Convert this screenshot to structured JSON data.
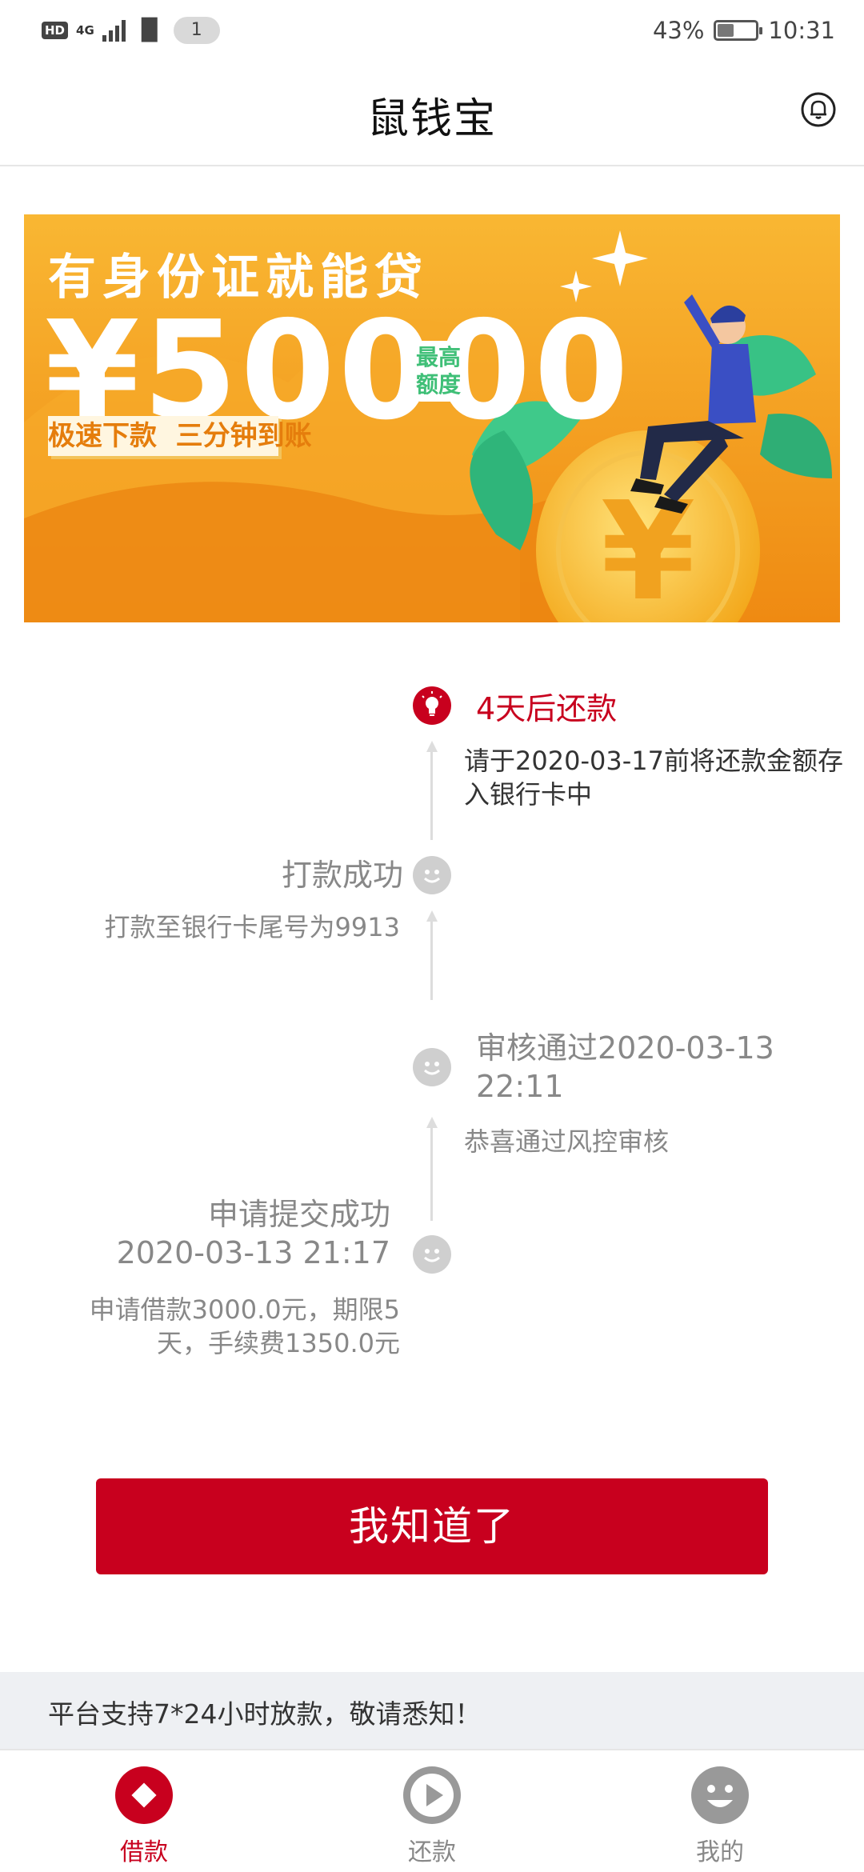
{
  "status_bar": {
    "hd": "HD",
    "network": "4G",
    "notification_count": "1",
    "battery_percent": "43%",
    "battery_level": 0.43,
    "time": "10:31"
  },
  "header": {
    "title": "鼠钱宝",
    "bell_icon": "bell-icon"
  },
  "banner": {
    "headline": "有身份证就能贷",
    "amount": "¥50000",
    "badge_line1": "最高",
    "badge_line2": "额度",
    "slogan": "极速下款  三分钟到账",
    "colors": {
      "bg": "#f5a623",
      "accent": "#e8760a"
    }
  },
  "timeline": {
    "steps": [
      {
        "title": "4天后还款",
        "desc": "请于2020-03-17前将还款金额存入银行卡中",
        "icon": "lightbulb-icon",
        "state": "current"
      },
      {
        "title": "打款成功",
        "desc": "打款至银行卡尾号为9913",
        "icon": "smile-icon",
        "state": "done"
      },
      {
        "title": "审核通过2020-03-13 22:11",
        "desc": "恭喜通过风控审核",
        "icon": "smile-icon",
        "state": "done"
      },
      {
        "title_line1": "申请提交成功",
        "title_line2": "2020-03-13 21:17",
        "desc_line1": "申请借款3000.0元，期限5",
        "desc_line2": "天，手续费1350.0元",
        "icon": "smile-icon",
        "state": "done"
      }
    ]
  },
  "confirm_button": {
    "label": "我知道了"
  },
  "notice": {
    "text": "平台支持7*24小时放款，敬请悉知！"
  },
  "bottom_nav": {
    "items": [
      {
        "label": "借款",
        "icon": "diamond-icon",
        "active": true
      },
      {
        "label": "还款",
        "icon": "play-icon",
        "active": false
      },
      {
        "label": "我的",
        "icon": "smile-face-icon",
        "active": false
      }
    ]
  },
  "colors": {
    "brand_red": "#c8001e",
    "inactive_gray": "#888888"
  }
}
